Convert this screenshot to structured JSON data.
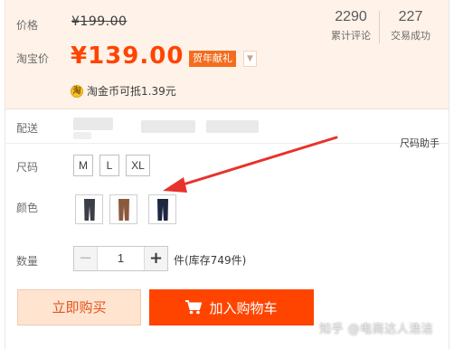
{
  "price_panel": {
    "price_label": "价格",
    "original_price": "¥199.00",
    "taobao_price_label": "淘宝价",
    "taobao_price": "¥139.00",
    "promo_badge": "贺年献礼",
    "promo_arrow": "▼",
    "stats": [
      {
        "value": "2290",
        "label": "累计评论"
      },
      {
        "value": "227",
        "label": "交易成功"
      }
    ],
    "coin_icon": "淘",
    "coin_text": "淘金币可抵1.39元"
  },
  "delivery": {
    "label": "配送",
    "size_helper": "尺码助手"
  },
  "size": {
    "label": "尺码",
    "options": [
      "M",
      "L",
      "XL"
    ]
  },
  "color": {
    "label": "颜色",
    "options": [
      {
        "icon": "pants-dark-gray-icon",
        "color": "#3a3f47"
      },
      {
        "icon": "pants-brown-icon",
        "color": "#8a5a3c"
      },
      {
        "icon": "pants-navy-icon",
        "color": "#1d2740"
      }
    ]
  },
  "quantity": {
    "label": "数量",
    "minus": "−",
    "value": "1",
    "plus": "+",
    "stock_text": "件(库存749件)"
  },
  "actions": {
    "buy_now": "立即购买",
    "add_to_cart": "加入购物车"
  },
  "watermark": "知乎 @电商达人浩洁",
  "colors": {
    "accent": "#ff4400",
    "price_bg": "#fff2e8",
    "annotation_arrow": "#e8322c"
  }
}
